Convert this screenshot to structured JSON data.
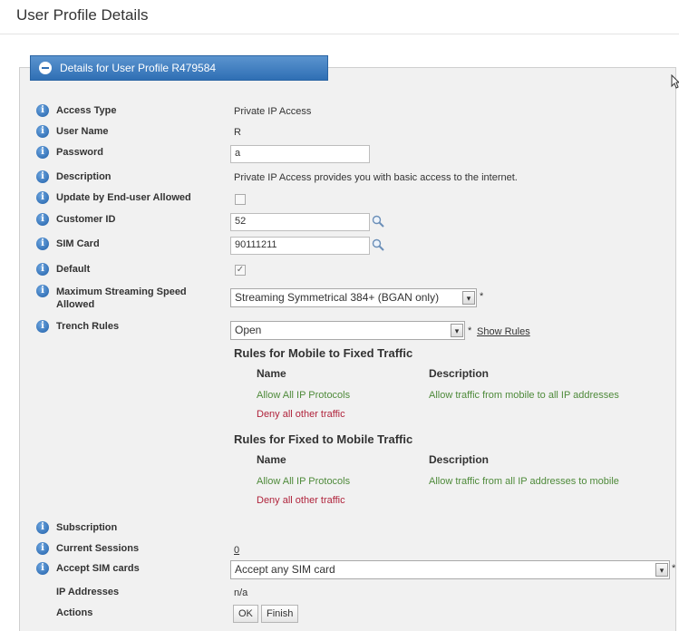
{
  "page": {
    "title": "User Profile Details"
  },
  "panel": {
    "header": "Details for User Profile R479584"
  },
  "fields": {
    "access_type": {
      "label": "Access Type",
      "value": "Private IP Access"
    },
    "user_name": {
      "label": "User Name",
      "value": "R"
    },
    "password": {
      "label": "Password",
      "value": "a"
    },
    "description": {
      "label": "Description",
      "value": "Private IP Access provides you with basic access to the internet."
    },
    "update_allowed": {
      "label": "Update by End-user Allowed",
      "checked": false
    },
    "customer_id": {
      "label": "Customer ID",
      "value": "52"
    },
    "sim_card": {
      "label": "SIM Card",
      "value": "90111211"
    },
    "default": {
      "label": "Default",
      "checked": true,
      "check_glyph": "✓"
    },
    "max_streaming": {
      "label": "Maximum Streaming Speed Allowed",
      "selected": "Streaming Symmetrical 384+ (BGAN only)",
      "required": "*"
    },
    "trench_rules": {
      "label": "Trench Rules",
      "selected": "Open",
      "required": "*",
      "show_rules_label": "Show Rules"
    },
    "subscription": {
      "label": "Subscription"
    },
    "current_sessions": {
      "label": "Current Sessions",
      "value": "0"
    },
    "accept_sim": {
      "label": "Accept SIM cards",
      "selected": "Accept any SIM card",
      "required": "*"
    },
    "ip_addresses": {
      "label": "IP Addresses",
      "value": "n/a"
    },
    "actions": {
      "label": "Actions",
      "ok_label": "OK",
      "finish_label": "Finish"
    }
  },
  "rules_mobile_to_fixed": {
    "heading": "Rules for Mobile to Fixed Traffic",
    "col_name": "Name",
    "col_description": "Description",
    "rows": [
      {
        "name": "Allow All IP Protocols",
        "description": "Allow traffic from mobile to all IP addresses"
      },
      {
        "name": "Deny all other traffic",
        "description": ""
      }
    ]
  },
  "rules_fixed_to_mobile": {
    "heading": "Rules for Fixed to Mobile Traffic",
    "col_name": "Name",
    "col_description": "Description",
    "rows": [
      {
        "name": "Allow All IP Protocols",
        "description": "Allow traffic from all IP addresses to mobile"
      },
      {
        "name": "Deny all other traffic",
        "description": ""
      }
    ]
  },
  "icons": {
    "info_glyph": "i",
    "arrow_glyph": "▾"
  },
  "colors": {
    "header_blue": "#2f6fb4",
    "allow_green": "#4e8a3a",
    "deny_red": "#b0243c"
  }
}
